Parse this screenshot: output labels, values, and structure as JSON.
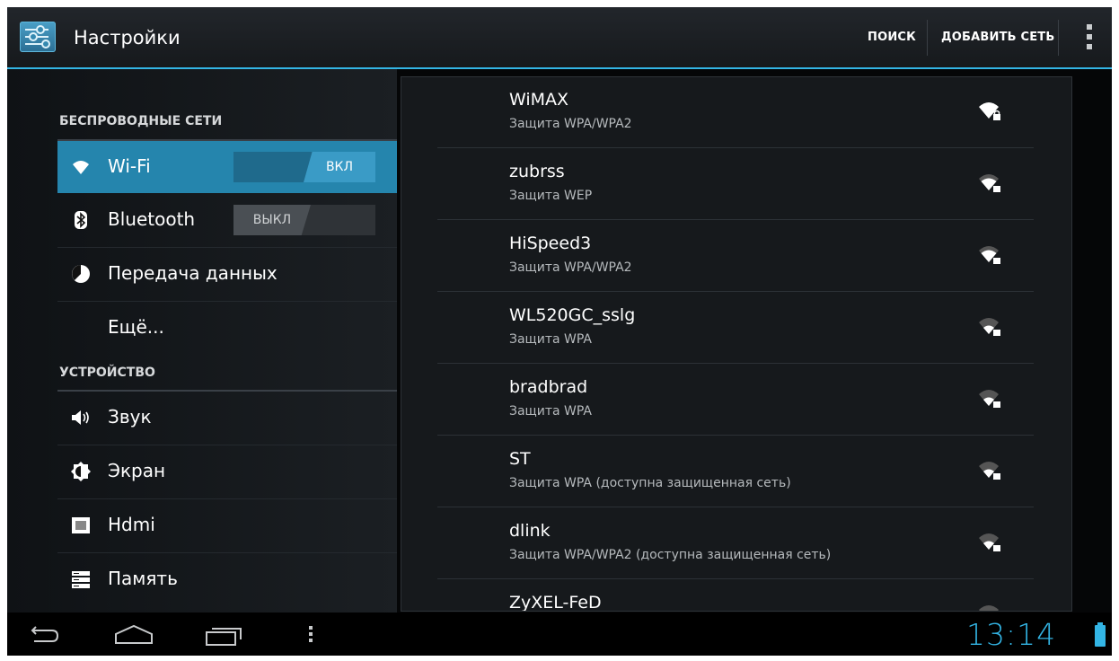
{
  "app": {
    "title": "Настройки",
    "icon": "settings-sliders-icon"
  },
  "actionbar": {
    "search_label": "ПОИСК",
    "add_network_label": "ДОБАВИТЬ СЕТЬ",
    "overflow_icon": "overflow-menu-icon"
  },
  "sidebar": {
    "sections": [
      {
        "header": "БЕСПРОВОДНЫЕ СЕТИ"
      },
      {
        "header": "УСТРОЙСТВО"
      }
    ],
    "items": [
      {
        "label": "Wi-Fi",
        "icon": "wifi-icon",
        "toggle": "ВКЛ",
        "selected": true
      },
      {
        "label": "Bluetooth",
        "icon": "bluetooth-icon",
        "toggle": "ВЫКЛ",
        "selected": false
      },
      {
        "label": "Передача данных",
        "icon": "data-usage-icon"
      },
      {
        "label": "Ещё..."
      },
      {
        "label": "Звук",
        "icon": "sound-icon"
      },
      {
        "label": "Экран",
        "icon": "display-brightness-icon"
      },
      {
        "label": "Hdmi",
        "icon": "hdmi-icon"
      },
      {
        "label": "Память",
        "icon": "storage-icon"
      }
    ]
  },
  "networks": [
    {
      "ssid": "WiMAX",
      "security": "Защита WPA/WPA2",
      "signal_icon": "wifi-lock-signal-icon",
      "strength": 4
    },
    {
      "ssid": "zubrss",
      "security": "Защита WEP",
      "signal_icon": "wifi-lock-signal-icon",
      "strength": 3
    },
    {
      "ssid": "HiSpeed3",
      "security": "Защита WPA/WPA2",
      "signal_icon": "wifi-lock-signal-icon",
      "strength": 3
    },
    {
      "ssid": "WL520GC_sslg",
      "security": "Защита WPA",
      "signal_icon": "wifi-lock-signal-icon",
      "strength": 2
    },
    {
      "ssid": "bradbrad",
      "security": "Защита WPA",
      "signal_icon": "wifi-lock-signal-icon",
      "strength": 2
    },
    {
      "ssid": "ST",
      "security": "Защита WPA (доступна защищенная сеть)",
      "signal_icon": "wifi-lock-signal-icon",
      "strength": 2
    },
    {
      "ssid": "dlink",
      "security": "Защита WPA/WPA2 (доступна защищенная сеть)",
      "signal_icon": "wifi-lock-signal-icon",
      "strength": 2
    },
    {
      "ssid": "ZyXEL-FeD",
      "security": "",
      "signal_icon": "wifi-lock-signal-icon",
      "strength": 1
    }
  ],
  "statusbar": {
    "time": "13:14",
    "battery_icon": "battery-icon"
  },
  "navbar": {
    "back": "back-icon",
    "home": "home-icon",
    "recents": "recent-apps-icon",
    "menu": "menu-dots-icon"
  },
  "colors": {
    "accent": "#33b5e5",
    "selected_row": "#2585ad",
    "background": "#0b0d10"
  }
}
